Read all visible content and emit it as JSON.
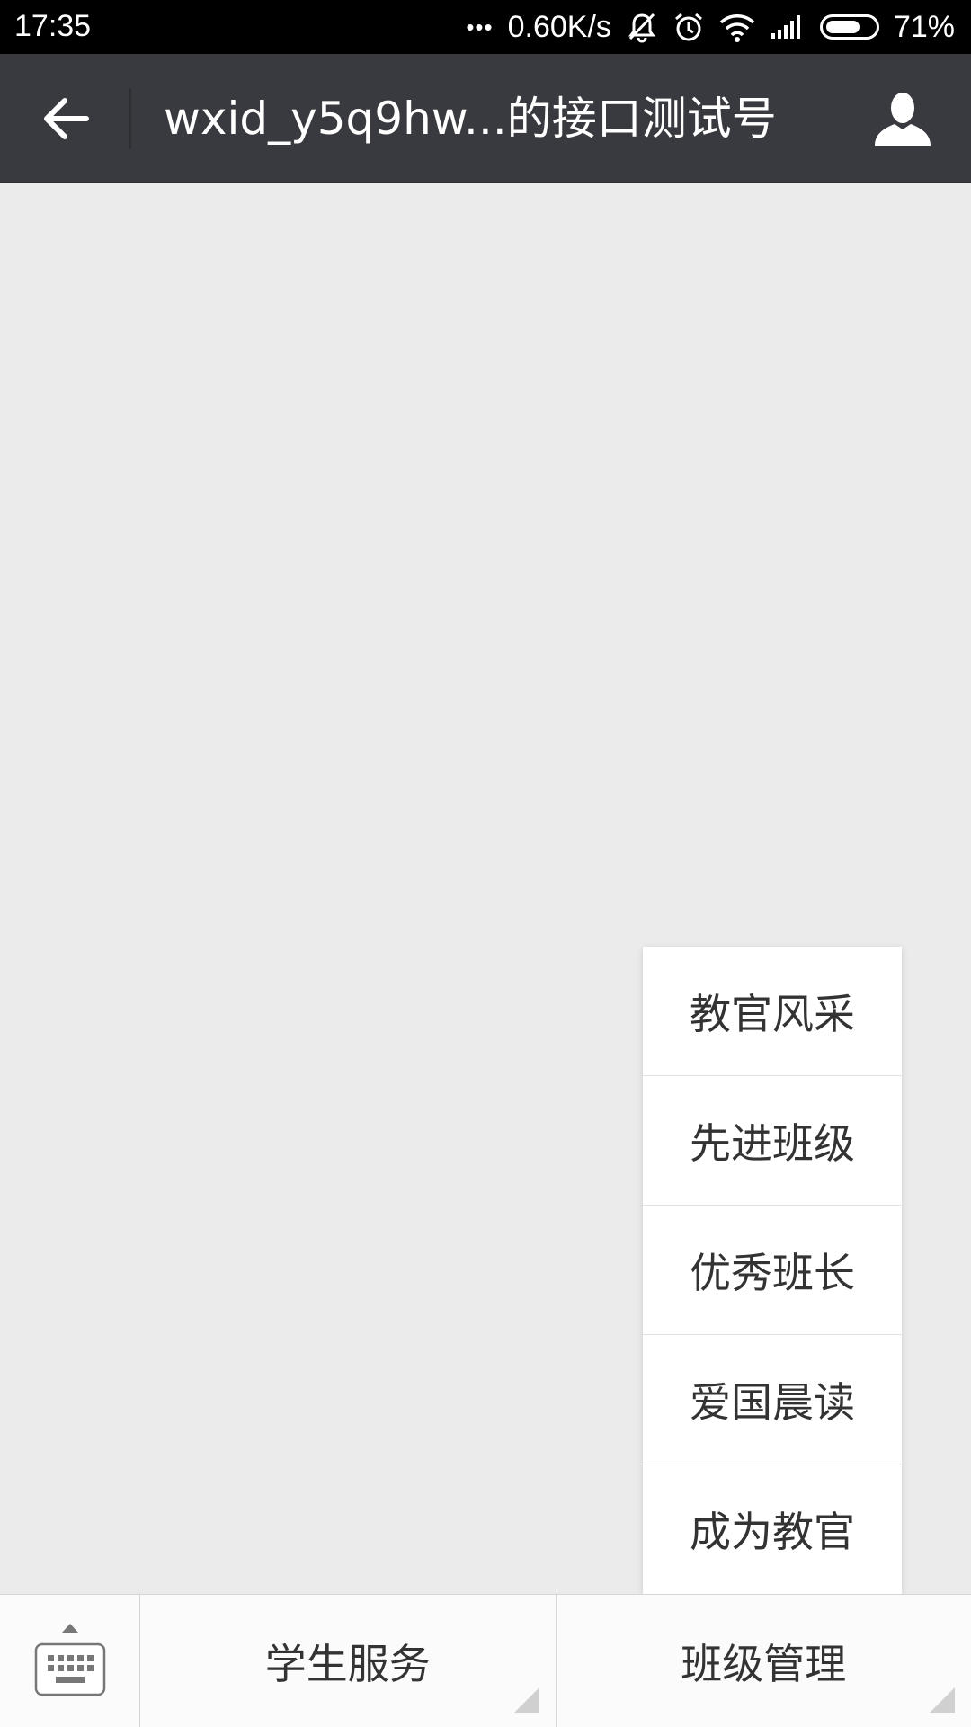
{
  "status_bar": {
    "time": "17:35",
    "dots": "•••",
    "net_speed": "0.60K/s",
    "battery_percent": "71%",
    "battery_level": 0.71,
    "icons": [
      "mute-icon",
      "alarm-icon",
      "wifi-icon",
      "signal-icon",
      "battery-icon"
    ]
  },
  "header": {
    "title": "wxid_y5q9hw...的接口测试号",
    "background": "#393a3f",
    "back_icon": "back-arrow-icon",
    "profile_icon": "person-icon"
  },
  "popup_menu": {
    "items": [
      "教官风采",
      "先进班级",
      "优秀班长",
      "爱国晨读",
      "成为教官"
    ]
  },
  "bottom_menu": {
    "keyboard_icon": "keyboard-icon",
    "tabs": [
      "学生服务",
      "班级管理"
    ]
  },
  "colors": {
    "page_background": "#ebebeb",
    "menu_background": "#ffffff",
    "text": "#333333"
  }
}
